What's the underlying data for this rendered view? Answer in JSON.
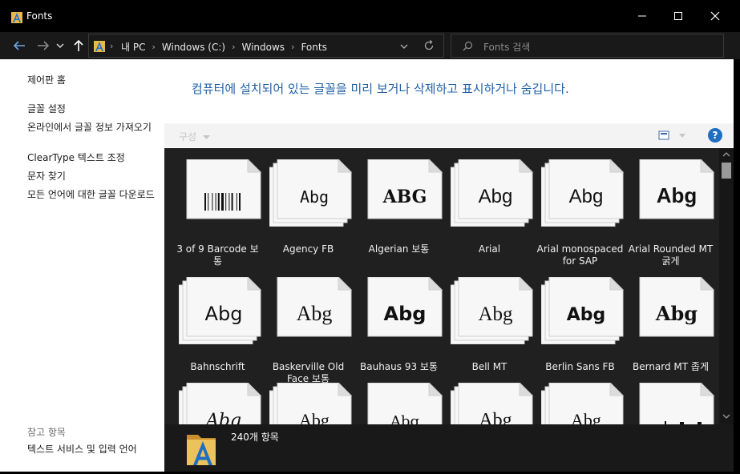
{
  "window": {
    "title": "Fonts",
    "accent": "#1f5fa6"
  },
  "address": {
    "crumbs": [
      "내 PC",
      "Windows  (C:)",
      "Windows",
      "Fonts"
    ],
    "search_placeholder": "Fonts 검색"
  },
  "sidebar": {
    "home": "제어판 홈",
    "links": [
      "글꼴 설정",
      "온라인에서 글꼴 정보 가져오기",
      "ClearType 텍스트 조정",
      "문자 찾기",
      "모든 언어에 대한 글꼴 다운로드"
    ],
    "see_also_heading": "참고 항목",
    "see_also": [
      "텍스트 서비스 및 입력 언어"
    ]
  },
  "main": {
    "headline": "컴퓨터에 설치되어 있는 글꼴을 미리 보거나 삭제하고 표시하거나 숨깁니다.",
    "organize_label": "구성"
  },
  "fonts": [
    {
      "name": "3 of 9 Barcode 보통",
      "preview": "barcode",
      "family_set": false
    },
    {
      "name": "Agency FB",
      "preview": "Abg",
      "family_set": true
    },
    {
      "name": "Algerian 보통",
      "preview": "ABG",
      "family_set": false
    },
    {
      "name": "Arial",
      "preview": "Abg",
      "family_set": true
    },
    {
      "name": "Arial monospaced for SAP",
      "preview": "Abg",
      "family_set": true
    },
    {
      "name": "Arial Rounded MT 굵게",
      "preview": "Abg",
      "family_set": false
    },
    {
      "name": "Bahnschrift",
      "preview": "Abg",
      "family_set": true
    },
    {
      "name": "Baskerville Old Face 보통",
      "preview": "Abg",
      "family_set": false
    },
    {
      "name": "Bauhaus 93 보통",
      "preview": "Abg",
      "family_set": false
    },
    {
      "name": "Bell MT",
      "preview": "Abg",
      "family_set": true
    },
    {
      "name": "Berlin Sans FB",
      "preview": "Abg",
      "family_set": true
    },
    {
      "name": "Bernard MT 좁게",
      "preview": "Abg",
      "family_set": false
    },
    {
      "name": "",
      "preview": "Abg",
      "family_set": true
    },
    {
      "name": "",
      "preview": "Abg",
      "family_set": true
    },
    {
      "name": "",
      "preview": "Abg",
      "family_set": false
    },
    {
      "name": "",
      "preview": "Abg",
      "family_set": true
    },
    {
      "name": "",
      "preview": "Abg",
      "family_set": true
    },
    {
      "name": "",
      "preview": "symbols",
      "family_set": false
    }
  ],
  "details": {
    "count": "240개 항목"
  }
}
